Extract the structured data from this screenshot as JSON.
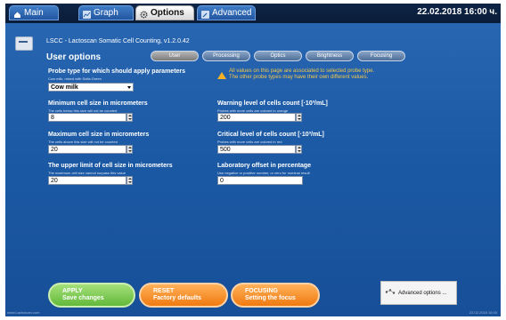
{
  "topbar": {
    "tabs": [
      {
        "label": "Main",
        "icon": "home-icon"
      },
      {
        "label": "Graph",
        "icon": "graph-icon"
      },
      {
        "label": "Options",
        "icon": "gear-icon"
      },
      {
        "label": "Advanced",
        "icon": "wrench-icon"
      }
    ],
    "active_tab": "Options",
    "datetime": "22.02.2018 16:00 ч."
  },
  "header": {
    "device_title": "LSCC - Lactoscan Somatic Cell Counting, v1.2.0.42",
    "page_title": "User options",
    "device_icon": "analyzer-device-icon"
  },
  "section_tabs": [
    "User",
    "Processing",
    "Optics",
    "Brightness",
    "Focusing"
  ],
  "active_section": "User",
  "warning": {
    "icon": "warning-triangle-icon",
    "line1": "All values on this page are associated to selected probe type.",
    "line2": "The other probe types may have their own different values."
  },
  "fields": {
    "probe_type": {
      "label": "Probe type for which should apply parameters",
      "hint": "Cow milk, mixed with Sofia Green",
      "value": "Cow milk"
    },
    "min_cell_size": {
      "label": "Minimum cell size in micrometers",
      "hint": "The cells below this size will not be counted",
      "value": "8"
    },
    "max_cell_size": {
      "label": "Maximum cell size in micrometers",
      "hint": "The cells above this size will not be counted",
      "value": "20"
    },
    "upper_limit": {
      "label": "The upper limit of cell size in micrometers",
      "hint": "The maximum cell size cannot surpass this value",
      "value": "20"
    },
    "warning_level": {
      "label": "Warning level of cells count [·10³/mL]",
      "hint": "Probes with more cells are colored in orange",
      "value": "200"
    },
    "critical_level": {
      "label": "Critical level of cells count [·10³/mL]",
      "hint": "Probes with more cells are colored in red",
      "value": "500"
    },
    "lab_offset": {
      "label": "Laboratory offset in percentage",
      "hint": "Use negative or positive number, or zero for nominal result",
      "value": "0"
    }
  },
  "buttons": {
    "apply": {
      "title": "APPLY",
      "subtitle": "Save changes",
      "color": "#62b93a"
    },
    "reset": {
      "title": "RESET",
      "subtitle": "Factory defaults",
      "color": "#f07a10"
    },
    "focusing": {
      "title": "FOCUSING",
      "subtitle": "Setting the focus",
      "color": "#f07a10"
    },
    "advanced_options": {
      "label": "Advanced options ...",
      "icon": "settings-dots-icon"
    }
  },
  "footer": {
    "left": "www.Lactoscan.com",
    "right": "22.02.2018 16:00"
  }
}
